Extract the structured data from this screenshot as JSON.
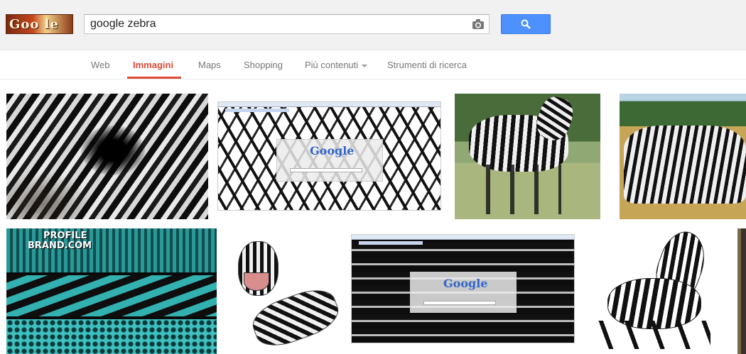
{
  "header": {
    "logo_text": "Goo le",
    "search": {
      "value": "google zebra",
      "placeholder": ""
    },
    "search_button_icon": "search-icon",
    "camera_icon": "camera-icon"
  },
  "nav": {
    "tabs": [
      {
        "label": "Web",
        "active": false
      },
      {
        "label": "Immagini",
        "active": true
      },
      {
        "label": "Maps",
        "active": false
      },
      {
        "label": "Shopping",
        "active": false
      },
      {
        "label": "Più contenuti",
        "active": false
      },
      {
        "label": "Strumenti di ricerca",
        "active": false
      }
    ]
  },
  "results": {
    "row1": [
      {
        "description": "zebra eye close-up"
      },
      {
        "description": "zebra google homepage"
      },
      {
        "description": "walking zebra"
      },
      {
        "description": "zebra herd"
      }
    ],
    "row2": [
      {
        "description": "profile brand zebra banner",
        "overlay_text_line1": "PROFILE",
        "overlay_text_line2": "BRAND.COM"
      },
      {
        "description": "cartoon zebra"
      },
      {
        "description": "zebra google homepage dark"
      },
      {
        "description": "zebra illustration"
      },
      {
        "description": "zebra partial"
      }
    ]
  },
  "mock_google_text": "Google",
  "colors": {
    "accent": "#dd4b39",
    "button": "#4d90fe",
    "topbar": "#f1f1f1"
  }
}
